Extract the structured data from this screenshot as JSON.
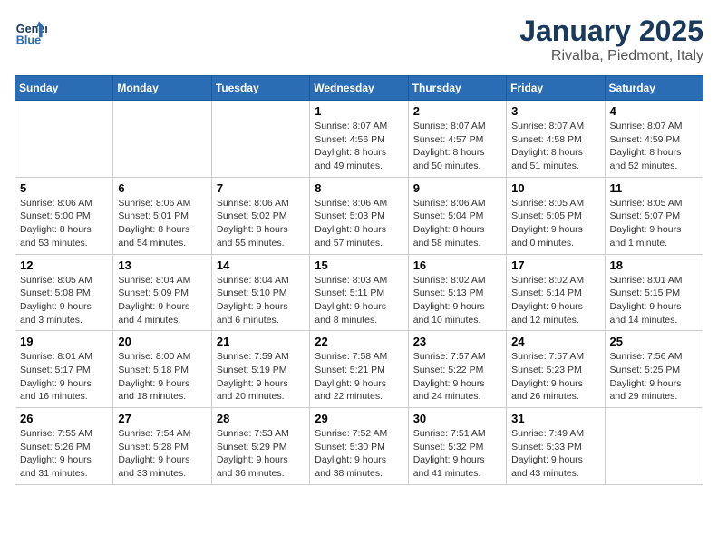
{
  "header": {
    "logo_line1": "General",
    "logo_line2": "Blue",
    "title": "January 2025",
    "location": "Rivalba, Piedmont, Italy"
  },
  "days_of_week": [
    "Sunday",
    "Monday",
    "Tuesday",
    "Wednesday",
    "Thursday",
    "Friday",
    "Saturday"
  ],
  "weeks": [
    [
      {
        "day": "",
        "info": ""
      },
      {
        "day": "",
        "info": ""
      },
      {
        "day": "",
        "info": ""
      },
      {
        "day": "1",
        "info": "Sunrise: 8:07 AM\nSunset: 4:56 PM\nDaylight: 8 hours\nand 49 minutes."
      },
      {
        "day": "2",
        "info": "Sunrise: 8:07 AM\nSunset: 4:57 PM\nDaylight: 8 hours\nand 50 minutes."
      },
      {
        "day": "3",
        "info": "Sunrise: 8:07 AM\nSunset: 4:58 PM\nDaylight: 8 hours\nand 51 minutes."
      },
      {
        "day": "4",
        "info": "Sunrise: 8:07 AM\nSunset: 4:59 PM\nDaylight: 8 hours\nand 52 minutes."
      }
    ],
    [
      {
        "day": "5",
        "info": "Sunrise: 8:06 AM\nSunset: 5:00 PM\nDaylight: 8 hours\nand 53 minutes."
      },
      {
        "day": "6",
        "info": "Sunrise: 8:06 AM\nSunset: 5:01 PM\nDaylight: 8 hours\nand 54 minutes."
      },
      {
        "day": "7",
        "info": "Sunrise: 8:06 AM\nSunset: 5:02 PM\nDaylight: 8 hours\nand 55 minutes."
      },
      {
        "day": "8",
        "info": "Sunrise: 8:06 AM\nSunset: 5:03 PM\nDaylight: 8 hours\nand 57 minutes."
      },
      {
        "day": "9",
        "info": "Sunrise: 8:06 AM\nSunset: 5:04 PM\nDaylight: 8 hours\nand 58 minutes."
      },
      {
        "day": "10",
        "info": "Sunrise: 8:05 AM\nSunset: 5:05 PM\nDaylight: 9 hours\nand 0 minutes."
      },
      {
        "day": "11",
        "info": "Sunrise: 8:05 AM\nSunset: 5:07 PM\nDaylight: 9 hours\nand 1 minute."
      }
    ],
    [
      {
        "day": "12",
        "info": "Sunrise: 8:05 AM\nSunset: 5:08 PM\nDaylight: 9 hours\nand 3 minutes."
      },
      {
        "day": "13",
        "info": "Sunrise: 8:04 AM\nSunset: 5:09 PM\nDaylight: 9 hours\nand 4 minutes."
      },
      {
        "day": "14",
        "info": "Sunrise: 8:04 AM\nSunset: 5:10 PM\nDaylight: 9 hours\nand 6 minutes."
      },
      {
        "day": "15",
        "info": "Sunrise: 8:03 AM\nSunset: 5:11 PM\nDaylight: 9 hours\nand 8 minutes."
      },
      {
        "day": "16",
        "info": "Sunrise: 8:02 AM\nSunset: 5:13 PM\nDaylight: 9 hours\nand 10 minutes."
      },
      {
        "day": "17",
        "info": "Sunrise: 8:02 AM\nSunset: 5:14 PM\nDaylight: 9 hours\nand 12 minutes."
      },
      {
        "day": "18",
        "info": "Sunrise: 8:01 AM\nSunset: 5:15 PM\nDaylight: 9 hours\nand 14 minutes."
      }
    ],
    [
      {
        "day": "19",
        "info": "Sunrise: 8:01 AM\nSunset: 5:17 PM\nDaylight: 9 hours\nand 16 minutes."
      },
      {
        "day": "20",
        "info": "Sunrise: 8:00 AM\nSunset: 5:18 PM\nDaylight: 9 hours\nand 18 minutes."
      },
      {
        "day": "21",
        "info": "Sunrise: 7:59 AM\nSunset: 5:19 PM\nDaylight: 9 hours\nand 20 minutes."
      },
      {
        "day": "22",
        "info": "Sunrise: 7:58 AM\nSunset: 5:21 PM\nDaylight: 9 hours\nand 22 minutes."
      },
      {
        "day": "23",
        "info": "Sunrise: 7:57 AM\nSunset: 5:22 PM\nDaylight: 9 hours\nand 24 minutes."
      },
      {
        "day": "24",
        "info": "Sunrise: 7:57 AM\nSunset: 5:23 PM\nDaylight: 9 hours\nand 26 minutes."
      },
      {
        "day": "25",
        "info": "Sunrise: 7:56 AM\nSunset: 5:25 PM\nDaylight: 9 hours\nand 29 minutes."
      }
    ],
    [
      {
        "day": "26",
        "info": "Sunrise: 7:55 AM\nSunset: 5:26 PM\nDaylight: 9 hours\nand 31 minutes."
      },
      {
        "day": "27",
        "info": "Sunrise: 7:54 AM\nSunset: 5:28 PM\nDaylight: 9 hours\nand 33 minutes."
      },
      {
        "day": "28",
        "info": "Sunrise: 7:53 AM\nSunset: 5:29 PM\nDaylight: 9 hours\nand 36 minutes."
      },
      {
        "day": "29",
        "info": "Sunrise: 7:52 AM\nSunset: 5:30 PM\nDaylight: 9 hours\nand 38 minutes."
      },
      {
        "day": "30",
        "info": "Sunrise: 7:51 AM\nSunset: 5:32 PM\nDaylight: 9 hours\nand 41 minutes."
      },
      {
        "day": "31",
        "info": "Sunrise: 7:49 AM\nSunset: 5:33 PM\nDaylight: 9 hours\nand 43 minutes."
      },
      {
        "day": "",
        "info": ""
      }
    ]
  ]
}
